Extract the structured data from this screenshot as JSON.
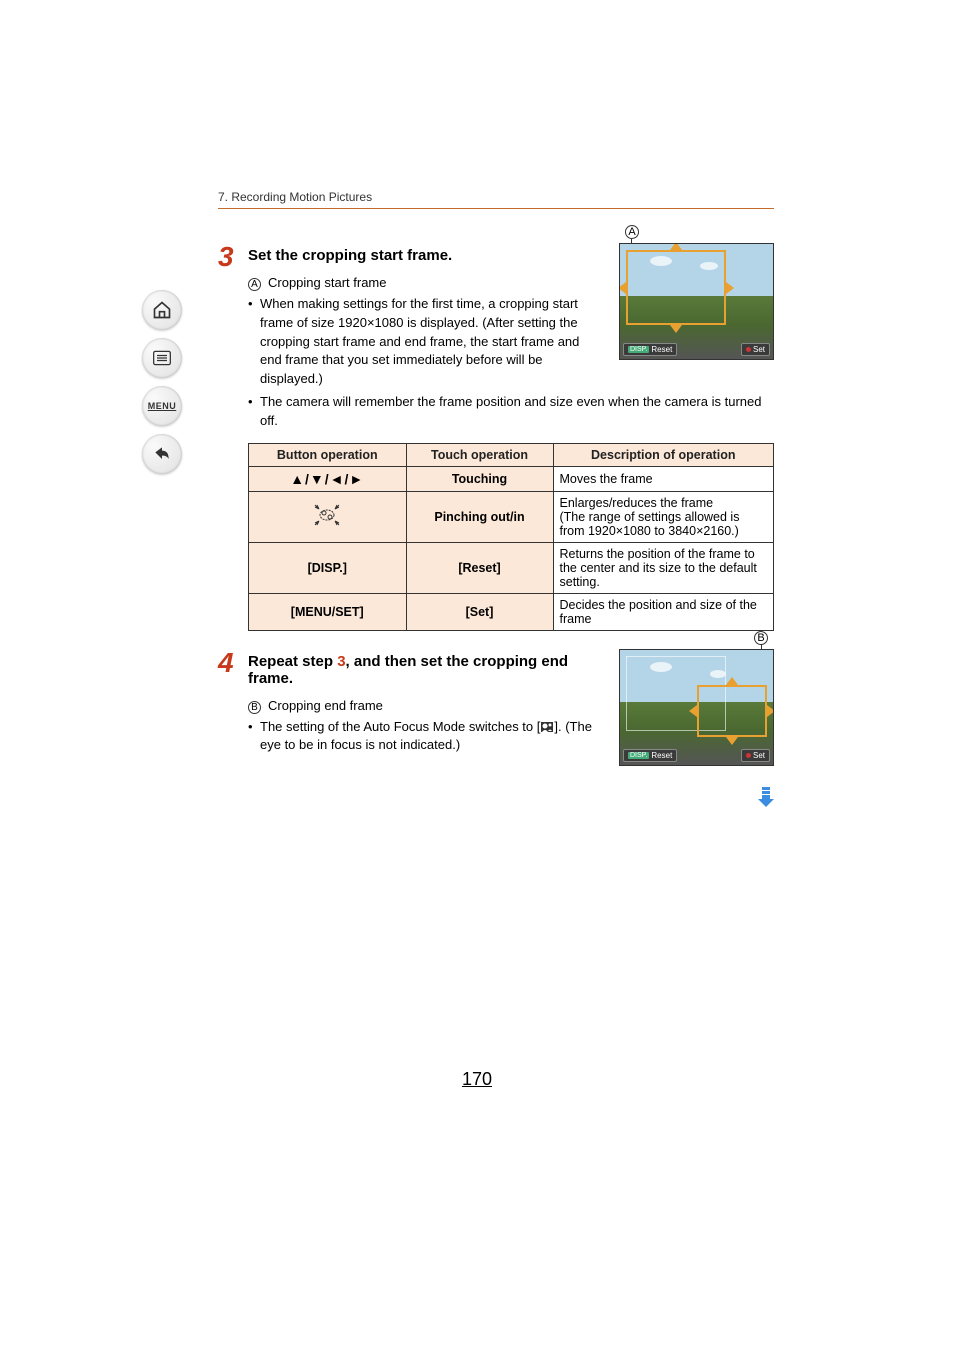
{
  "breadcrumb": "7. Recording Motion Pictures",
  "sidebar": {
    "home": "home",
    "toc": "toc",
    "menu": "MENU",
    "back": "back"
  },
  "step3": {
    "num": "3",
    "title": "Set the cropping start frame.",
    "label_a": "A",
    "item_a": "Cropping start frame",
    "bullet1": "When making settings for the first time, a cropping start frame of size 1920×1080 is displayed. (After setting the cropping start frame and end frame, the start frame and end frame that you set immediately before will be displayed.)",
    "bullet2": "The camera will remember the frame position and size even when the camera is turned off.",
    "illus_disp": "DISP.",
    "illus_reset": "Reset",
    "illus_set": "Set"
  },
  "table": {
    "h_btn": "Button operation",
    "h_touch": "Touch operation",
    "h_desc": "Description of operation",
    "r1_btn": "▲/▼/◄/►",
    "r1_touch": "Touching",
    "r1_desc": "Moves the frame",
    "r2_touch": "Pinching out/in",
    "r2_desc": "Enlarges/reduces the frame\n(The range of settings allowed is from 1920×1080 to 3840×2160.)",
    "r3_btn": "[DISP.]",
    "r3_touch": "[Reset]",
    "r3_desc": "Returns the position of the frame to the center and its size to the default setting.",
    "r4_btn": "[MENU/SET]",
    "r4_touch": "[Set]",
    "r4_desc": "Decides the position and size of the frame"
  },
  "step4": {
    "num": "4",
    "title_pre": "Repeat step ",
    "title_ref": "3",
    "title_post": ", and then set the cropping end frame.",
    "label_b": "B",
    "item_b": "Cropping end frame",
    "bullet1_pre": "The setting of the Auto Focus Mode switches to [",
    "bullet1_post": "]. (The eye to be in focus is not indicated.)",
    "illus_disp": "DISP.",
    "illus_reset": "Reset",
    "illus_set": "Set"
  },
  "page_number": "170"
}
